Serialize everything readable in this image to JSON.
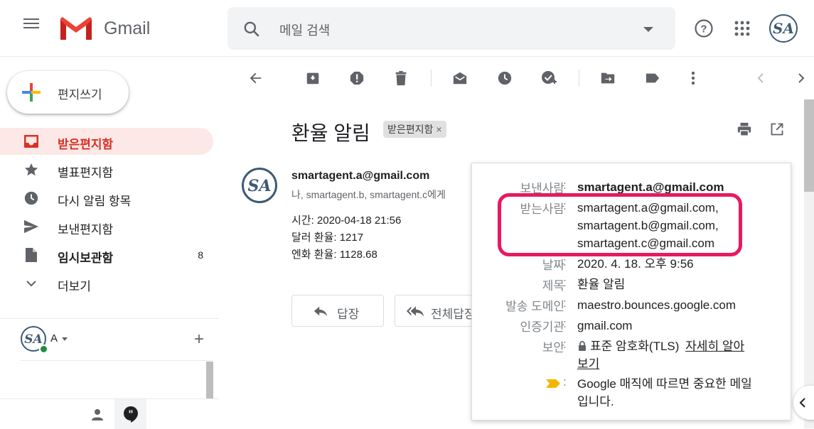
{
  "header": {
    "app_name": "Gmail",
    "search_placeholder": "메일 검색"
  },
  "sidebar": {
    "compose_label": "편지쓰기",
    "items": [
      {
        "label": "받은편지함",
        "icon": "inbox-icon",
        "active": true
      },
      {
        "label": "별표편지함",
        "icon": "star-icon"
      },
      {
        "label": "다시 알림 항목",
        "icon": "clock-icon"
      },
      {
        "label": "보낸편지함",
        "icon": "send-icon"
      },
      {
        "label": "임시보관함",
        "icon": "draft-icon",
        "count": "8",
        "bold": true
      },
      {
        "label": "더보기",
        "icon": "chevron-down-icon"
      }
    ],
    "hangouts": {
      "name": "A"
    }
  },
  "toolbar": {
    "icons": [
      "back-icon",
      "archive-icon",
      "report-spam-icon",
      "delete-icon",
      "mark-unread-icon",
      "snooze-icon",
      "add-task-icon",
      "move-to-icon",
      "label-icon",
      "more-icon",
      "prev-icon",
      "next-icon"
    ]
  },
  "message": {
    "subject": "환율 알림",
    "label_chip": "받은편지함",
    "sender": "smartagent.a@gmail.com",
    "to_line": "나, smartagent.b, smartagent.c에게",
    "body": [
      "시간: 2020-04-18 21:56",
      "달러 환율: 1217",
      "엔화 환율: 1128.68"
    ],
    "reply_label": "답장",
    "reply_all_label": "전체답장"
  },
  "details": {
    "from_key": "보낸사람",
    "from_val": "smartagent.a@gmail.com",
    "to_key": "받는사람",
    "to_vals": [
      "smartagent.a@gmail.com,",
      "smartagent.b@gmail.com,",
      "smartagent.c@gmail.com"
    ],
    "date_key": "날짜",
    "date_val": "2020. 4. 18. 오후 9:56",
    "subject_key": "제목",
    "subject_val": "환율 알림",
    "mailed_by_key": "발송 도메인",
    "mailed_by_val": "maestro.bounces.google.com",
    "signed_by_key": "인증기관",
    "signed_by_val": "gmail.com",
    "security_key": "보안",
    "security_val": "표준 암호화(TLS)",
    "security_link_1": "자세히 알아",
    "security_link_2": "보기",
    "importance_line_1": "Google 매직에 따르면 중요한 메일",
    "importance_line_2": "입니다."
  },
  "colors": {
    "highlight": "#e8195e",
    "active_nav": "#fce8e6",
    "active_text": "#d93025",
    "importance": "#f4b400"
  }
}
